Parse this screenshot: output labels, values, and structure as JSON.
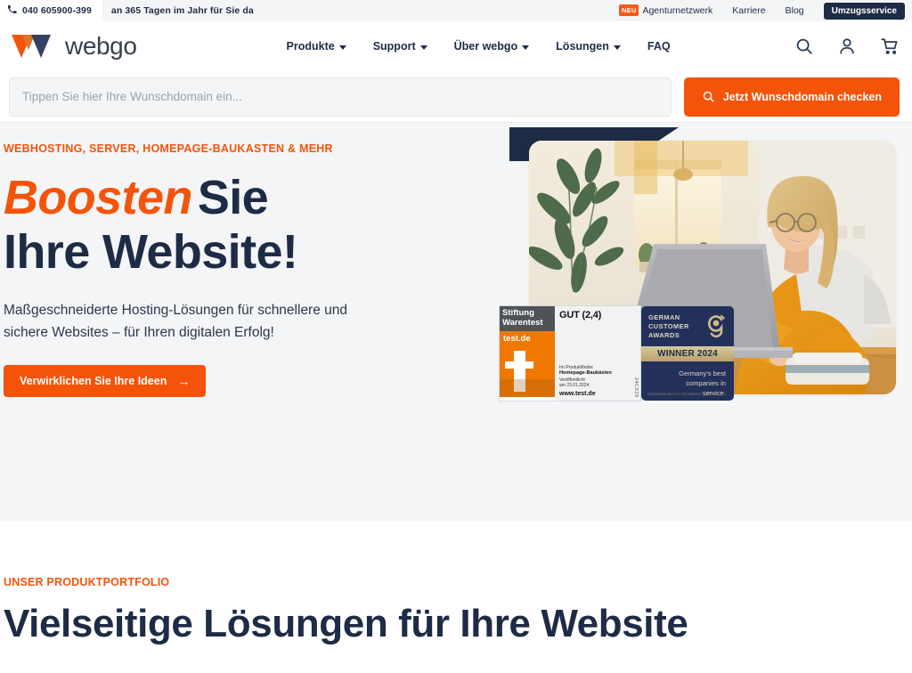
{
  "topbar": {
    "phone_icon": "phone-icon",
    "phone": "040 605900-399",
    "tagline": "an 365 Tagen im Jahr für Sie da",
    "neu_badge": "NEU",
    "links": [
      "Agenturnetzwerk",
      "Karriere",
      "Blog"
    ],
    "cta": "Umzugsservice"
  },
  "header": {
    "logo_text": "webgo",
    "nav": [
      {
        "label": "Produkte",
        "has_caret": true
      },
      {
        "label": "Support",
        "has_caret": true
      },
      {
        "label": "Über webgo",
        "has_caret": true
      },
      {
        "label": "Lösungen",
        "has_caret": true
      },
      {
        "label": "FAQ",
        "has_caret": false
      }
    ],
    "icons": [
      "search-icon",
      "account-icon",
      "cart-icon"
    ]
  },
  "domain_search": {
    "placeholder": "Tippen Sie hier Ihre Wunschdomain ein...",
    "value": "",
    "button_label": "Jetzt Wunschdomain checken",
    "button_icon": "search-icon"
  },
  "hero": {
    "eyebrow": "WEBHOSTING, SERVER, HOMEPAGE-BAUKASTEN & MEHR",
    "headline_accent": "Boosten",
    "headline_rest": "Sie",
    "headline_line2": "Ihre Website!",
    "subtitle_line1": "Maßgeschneiderte Hosting-Lösungen für schnellere und",
    "subtitle_line2": "sichere Websites – für Ihren digitalen Erfolg!",
    "cta_label": "Verwirklichen Sie Ihre Ideen",
    "cta_arrow": "→",
    "image_alt": "Frau mit Laptop am Schreibtisch"
  },
  "badges": {
    "stiftung": {
      "title_line1": "Stiftung",
      "title_line2": "Warentest",
      "testde": "test.de",
      "grade": "GUT (2,4)",
      "info_line1": "Im Produktfinder",
      "info_line2": "Homepage-Baukästen",
      "info_line3": "Veröffentlicht",
      "info_line4": "am 23.01.2024",
      "url": "www.test.de",
      "code": "24CX29"
    },
    "gca": {
      "line1": "GERMAN",
      "line2": "CUSTOMER",
      "line3": "AWARDS",
      "asterisk": "*",
      "winner": "WINNER 2024",
      "sub_line1": "Germany's best",
      "sub_line2": "companies in",
      "sub_line3": "service.",
      "fine_print": "DEUTSCHES INSTITUT FÜR SERVICE-QUALITÄT"
    }
  },
  "portfolio": {
    "eyebrow": "UNSER PRODUKTPORTFOLIO",
    "title": "Vielseitige Lösungen für Ihre Website"
  },
  "colors": {
    "orange": "#f4540a",
    "navy": "#1e2b45",
    "light_gray": "#f4f5f7",
    "badge_gold": "#c9b584"
  }
}
